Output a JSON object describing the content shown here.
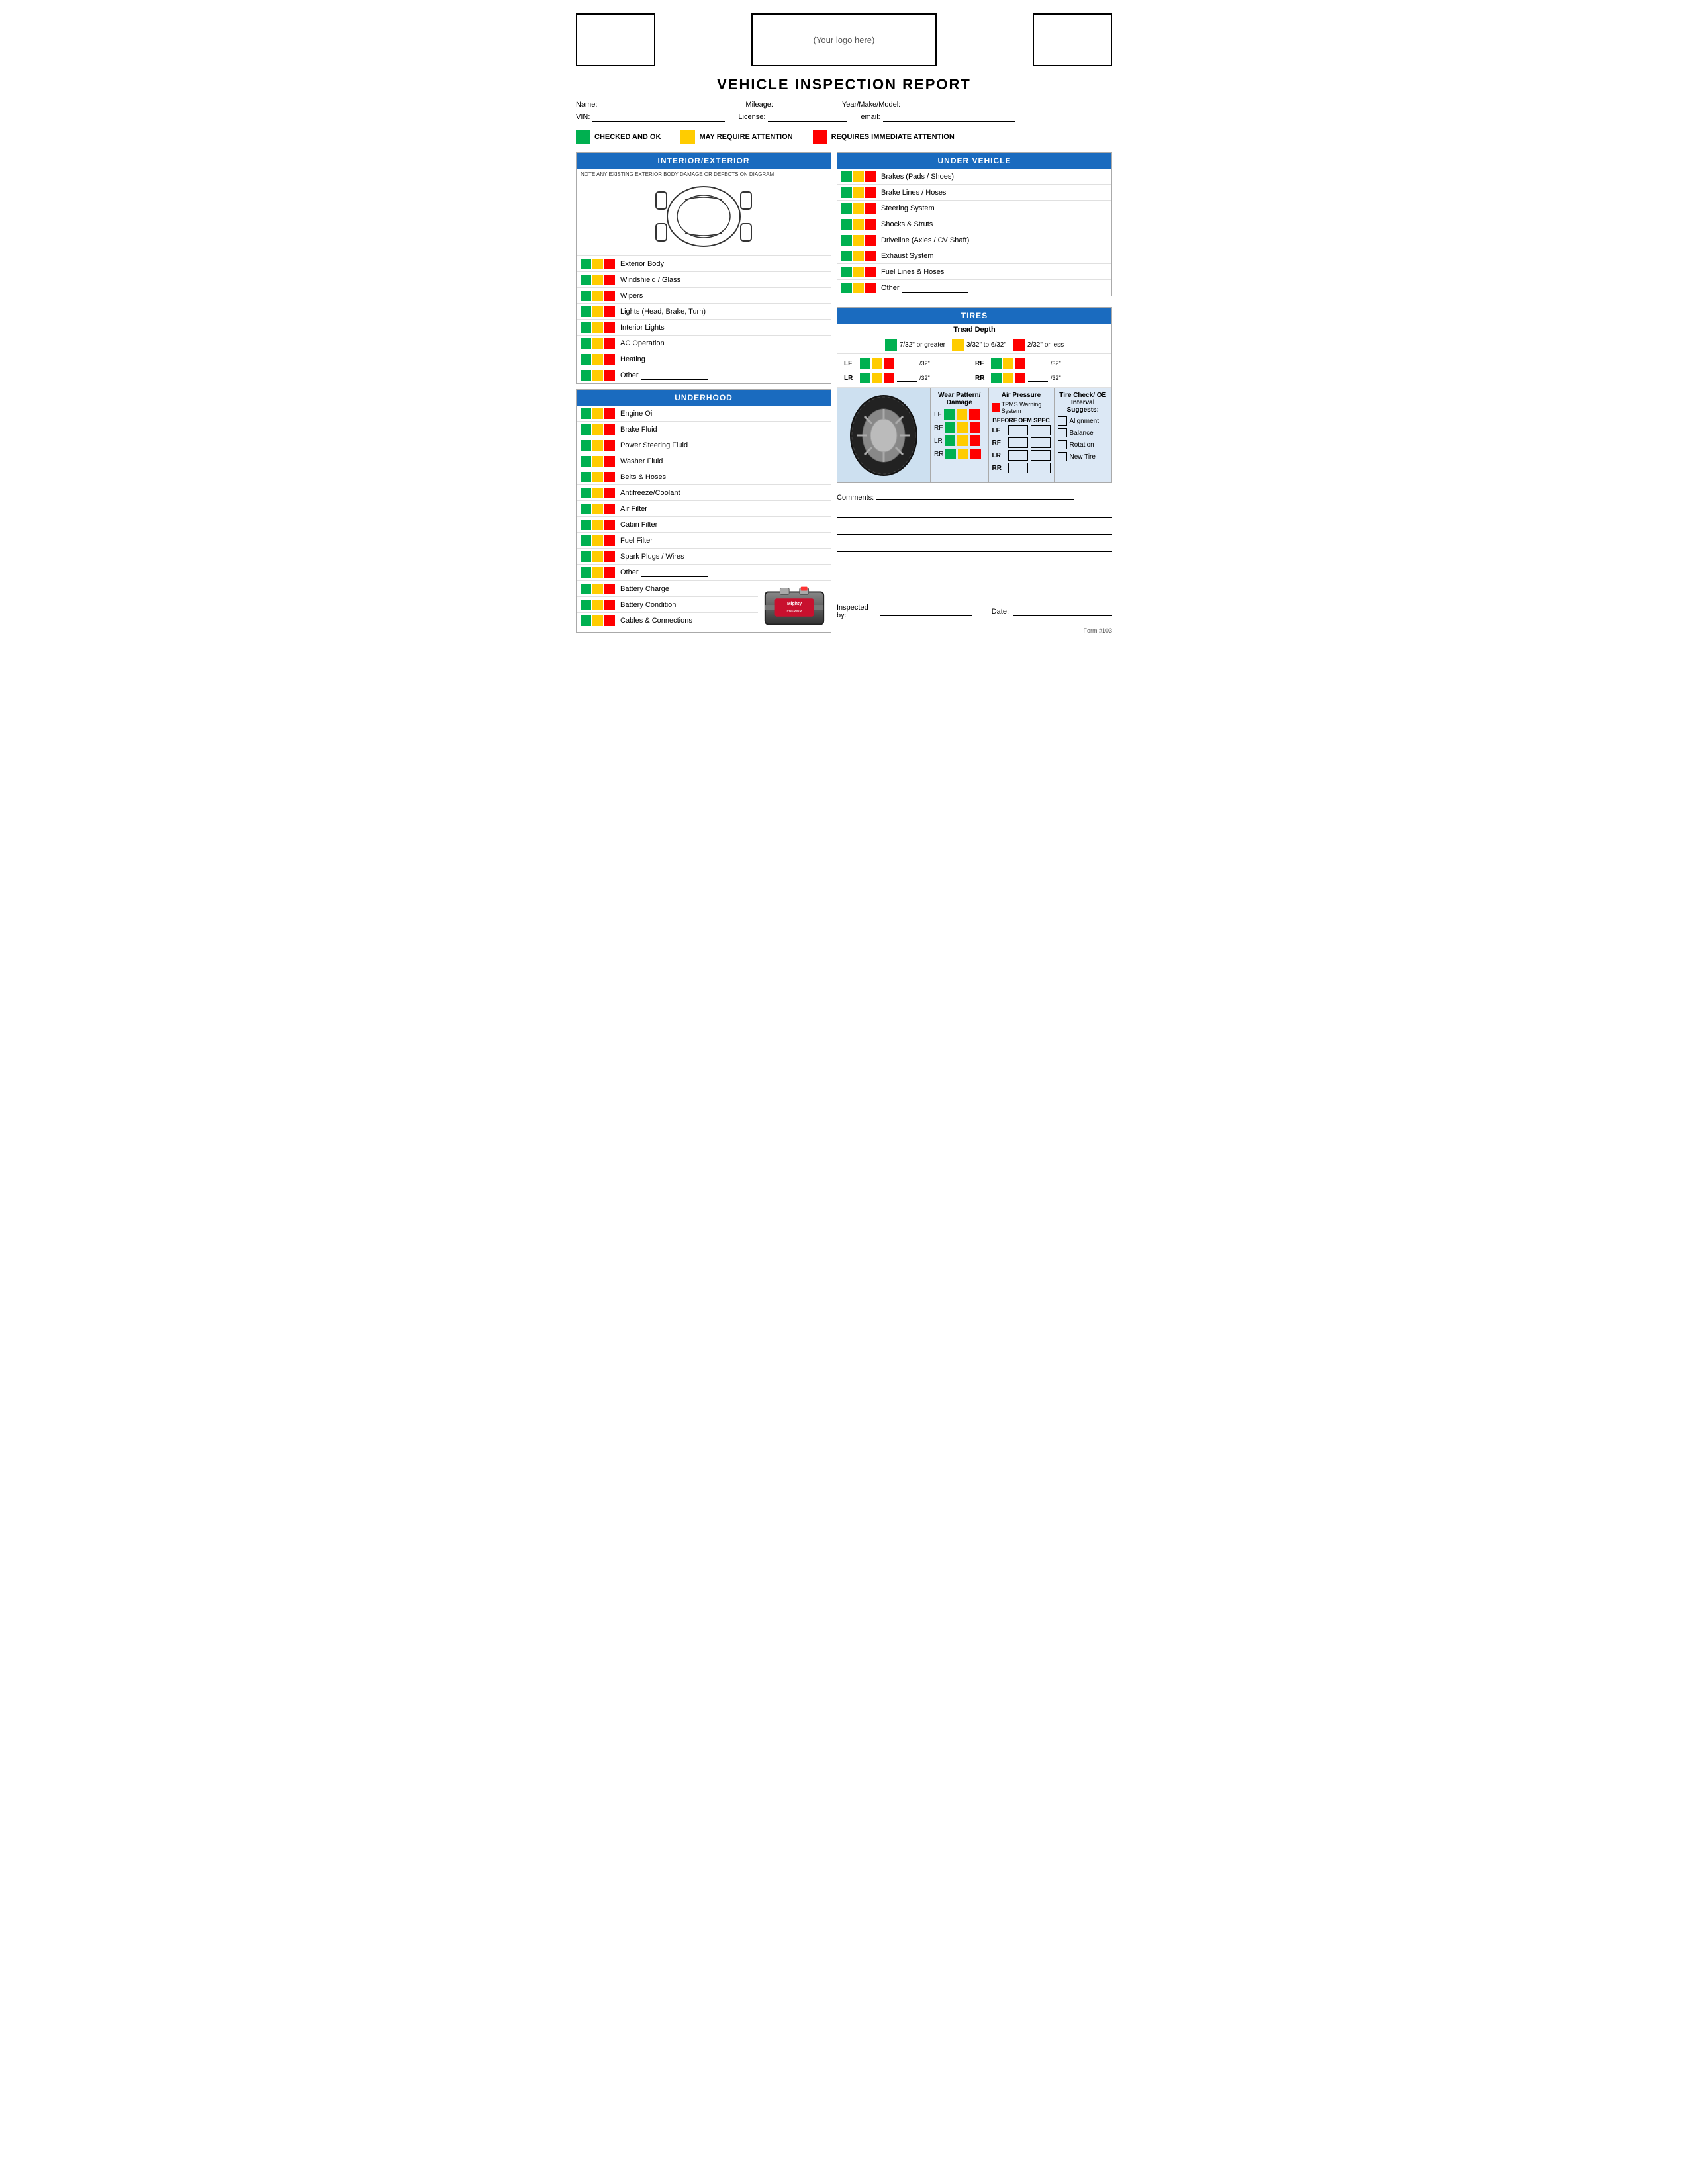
{
  "header": {
    "logo_placeholder": "(Your logo here)"
  },
  "title": "VEHICLE INSPECTION REPORT",
  "form_fields": {
    "name_label": "Name:",
    "mileage_label": "Mileage:",
    "year_make_model_label": "Year/Make/Model:",
    "vin_label": "VIN:",
    "license_label": "License:",
    "email_label": "email:"
  },
  "legend": {
    "checked_ok": "CHECKED AND OK",
    "may_require": "MAY REQUIRE ATTENTION",
    "requires_immediate": "REQUIRES IMMEDIATE ATTENTION"
  },
  "interior_exterior": {
    "title": "INTERIOR/EXTERIOR",
    "note": "NOTE ANY EXISTING EXTERIOR BODY DAMAGE OR DEFECTS ON DIAGRAM",
    "items": [
      {
        "label": "Exterior Body"
      },
      {
        "label": "Windshield / Glass"
      },
      {
        "label": "Wipers"
      },
      {
        "label": "Lights (Head, Brake, Turn)"
      },
      {
        "label": "Interior Lights"
      },
      {
        "label": "AC Operation"
      },
      {
        "label": "Heating"
      },
      {
        "label": "Other",
        "has_line": true
      }
    ]
  },
  "underhood": {
    "title": "UNDERHOOD",
    "items": [
      {
        "label": "Engine Oil"
      },
      {
        "label": "Brake Fluid"
      },
      {
        "label": "Power Steering Fluid"
      },
      {
        "label": "Washer Fluid"
      },
      {
        "label": "Belts & Hoses"
      },
      {
        "label": "Antifreeze/Coolant"
      },
      {
        "label": "Air Filter"
      },
      {
        "label": "Cabin Filter"
      },
      {
        "label": "Fuel Filter"
      },
      {
        "label": "Spark Plugs / Wires"
      },
      {
        "label": "Other",
        "has_line": true
      }
    ],
    "battery_items": [
      {
        "label": "Battery Charge"
      },
      {
        "label": "Battery Condition"
      },
      {
        "label": "Cables & Connections"
      }
    ]
  },
  "under_vehicle": {
    "title": "UNDER VEHICLE",
    "items": [
      {
        "label": "Brakes (Pads / Shoes)"
      },
      {
        "label": "Brake Lines / Hoses"
      },
      {
        "label": "Steering System"
      },
      {
        "label": "Shocks & Struts"
      },
      {
        "label": "Driveline (Axles / CV Shaft)"
      },
      {
        "label": "Exhaust System"
      },
      {
        "label": "Fuel Lines & Hoses"
      },
      {
        "label": "Other",
        "has_line": true
      }
    ]
  },
  "tires": {
    "title": "TIRES",
    "tread_depth_title": "Tread Depth",
    "tread_legend": [
      {
        "color": "green",
        "label": "7/32\" or greater"
      },
      {
        "color": "yellow",
        "label": "3/32\" to 6/32\""
      },
      {
        "color": "red",
        "label": "2/32\" or less"
      }
    ],
    "tire_positions": [
      {
        "pos": "LF",
        "unit": "/32\""
      },
      {
        "pos": "RF",
        "unit": "/32\""
      },
      {
        "pos": "LR",
        "unit": "/32\""
      },
      {
        "pos": "RR",
        "unit": "/32\""
      }
    ],
    "wear_pattern_header": "Wear Pattern/ Damage",
    "wear_positions": [
      "LF",
      "RF",
      "LR",
      "RR"
    ],
    "air_pressure_header": "Air Pressure",
    "tpms_label": "TPMS Warning System",
    "before_label": "BEFORE",
    "oemspec_label": "OEM SPEC",
    "pressure_positions": [
      "LF",
      "RF",
      "LR",
      "RR"
    ],
    "tire_check_header": "Tire Check/ OE Interval Suggests:",
    "tire_check_items": [
      "Alignment",
      "Balance",
      "Rotation",
      "New Tire"
    ]
  },
  "comments": {
    "label": "Comments:"
  },
  "signature": {
    "inspected_by": "Inspected by:",
    "date": "Date:"
  },
  "form_number": "Form #103"
}
